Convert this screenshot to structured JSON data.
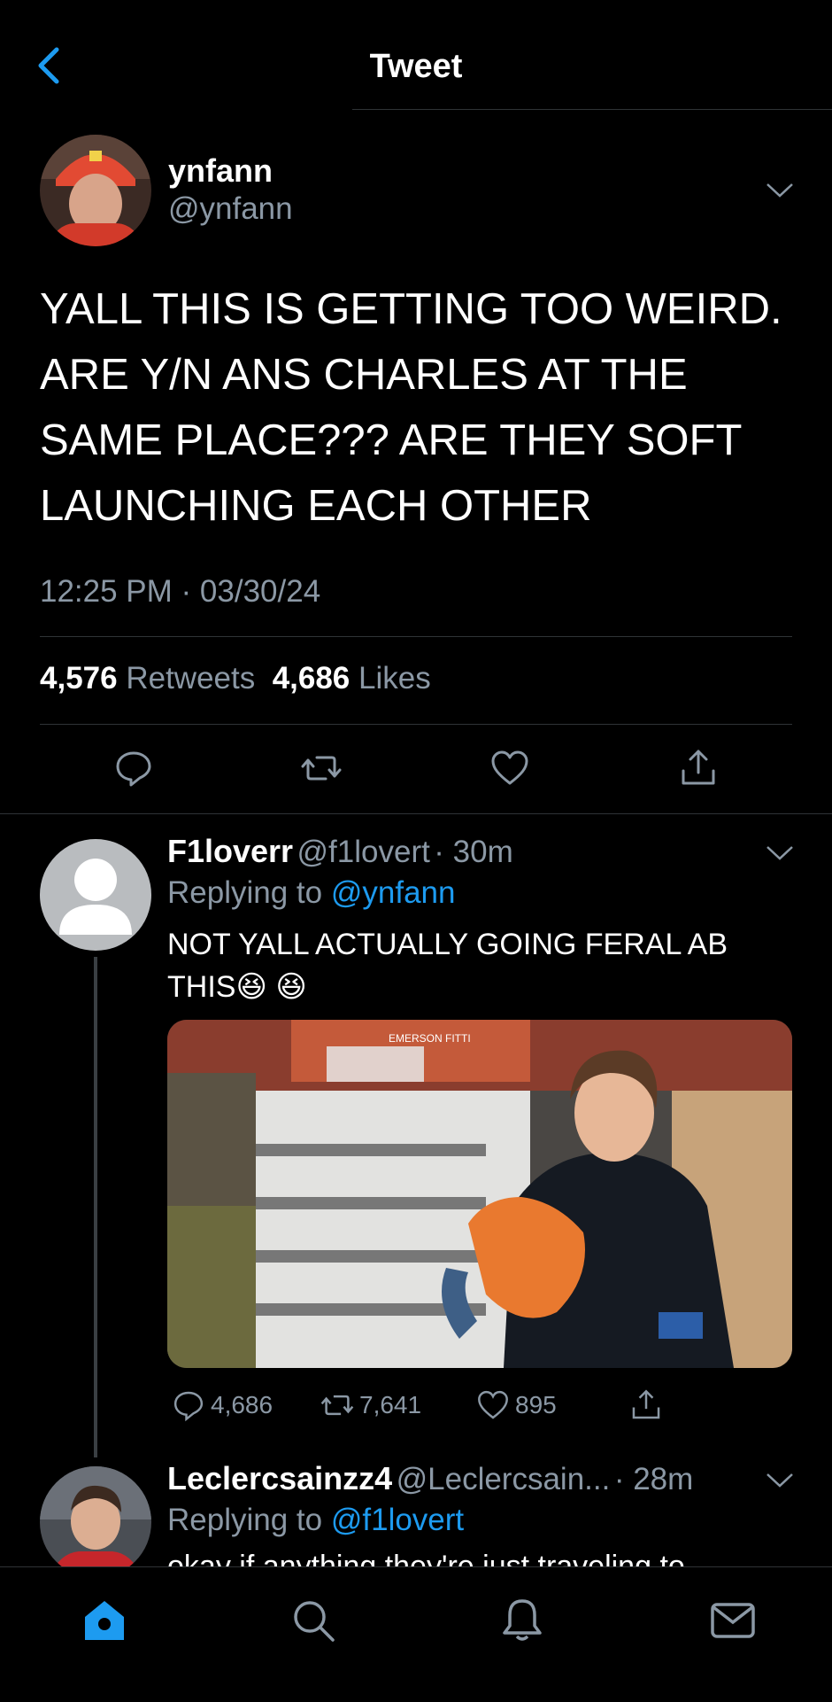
{
  "header": {
    "title": "Tweet",
    "back_icon": "chevron-left-icon"
  },
  "colors": {
    "accent": "#1d9bf0",
    "muted": "#8b98a5",
    "background": "#000000"
  },
  "tweet": {
    "author_name": "ynfann",
    "author_handle": "@ynfann",
    "text": "YALL THIS IS GETTING TOO WEIRD. ARE Y/N ANS CHARLES AT THE SAME PLACE??? ARE THEY SOFT LAUNCHING EACH OTHER",
    "timestamp": "12:25 PM · 03/30/24",
    "retweets_count": "4,576",
    "retweets_label": "Retweets",
    "likes_count": "4,686",
    "likes_label": "Likes",
    "actions": [
      "reply-icon",
      "retweet-icon",
      "like-icon",
      "share-icon"
    ]
  },
  "replies": [
    {
      "author_name": "F1loverr",
      "author_handle": "@f1lovert",
      "time": "· 30m",
      "replying_prefix": "Replying to",
      "replying_to": "@ynfann",
      "text": "NOT YALL ACTUALLY GOING FERAL AB THIS😆 😆",
      "media_text": "EMERSON FITTI",
      "reply_count": "4,686",
      "retweet_count": "7,641",
      "like_count": "895"
    },
    {
      "author_name": "Leclercsainzz4",
      "author_handle": "@Leclercsain...",
      "time": "· 28m",
      "replying_prefix": "Replying to",
      "replying_to": "@f1lovert",
      "text_partial": "okay if anything they're just traveling to"
    }
  ],
  "tabbar": {
    "items": [
      "home-icon",
      "search-icon",
      "notifications-icon",
      "messages-icon"
    ],
    "active": "home-icon"
  }
}
